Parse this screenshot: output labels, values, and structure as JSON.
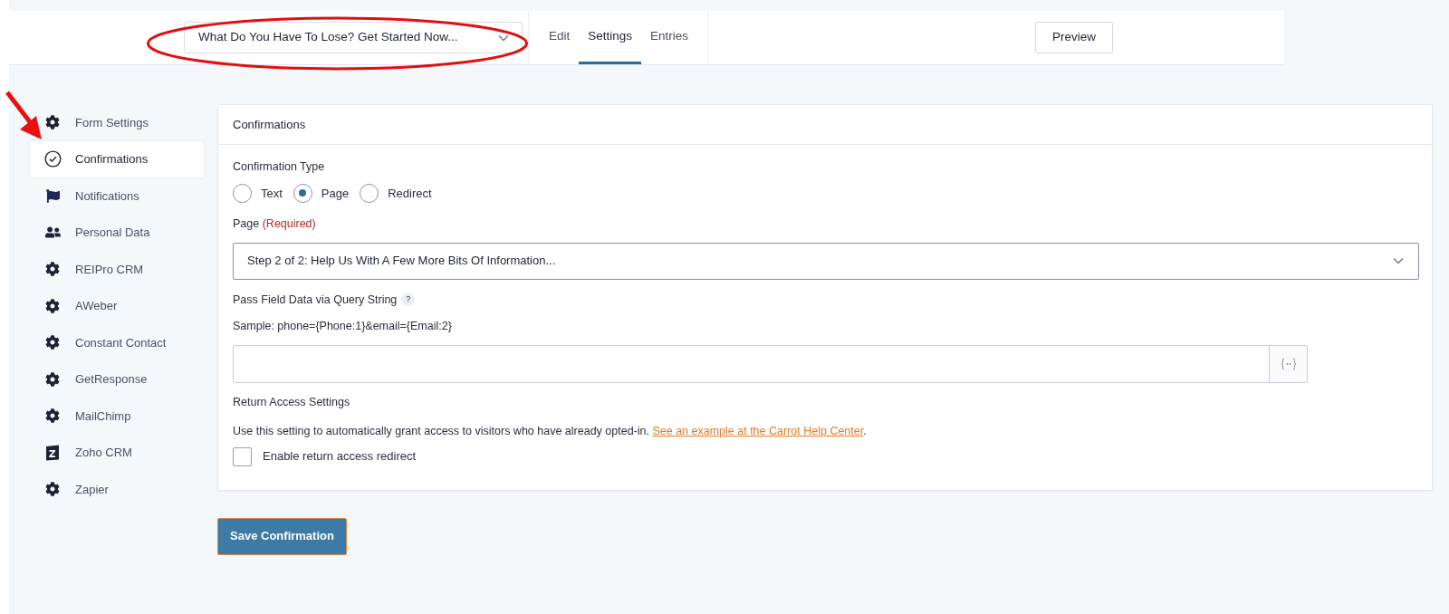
{
  "form_selector": {
    "value": "What Do You Have To Lose? Get Started Now..."
  },
  "tabs": [
    {
      "label": "Edit",
      "selected": false
    },
    {
      "label": "Settings",
      "selected": true
    },
    {
      "label": "Entries",
      "selected": false
    }
  ],
  "preview_button": "Preview",
  "sidebar": {
    "items": [
      {
        "label": "Form Settings",
        "kind": "gear",
        "selected": false
      },
      {
        "label": "Confirmations",
        "kind": "check",
        "selected": true
      },
      {
        "label": "Notifications",
        "kind": "flag",
        "selected": false
      },
      {
        "label": "Personal Data",
        "kind": "people",
        "selected": false
      },
      {
        "label": "REIPro CRM",
        "kind": "gear",
        "selected": false
      },
      {
        "label": "AWeber",
        "kind": "gear",
        "selected": false
      },
      {
        "label": "Constant Contact",
        "kind": "gear",
        "selected": false
      },
      {
        "label": "GetResponse",
        "kind": "gear",
        "selected": false
      },
      {
        "label": "MailChimp",
        "kind": "gear",
        "selected": false
      },
      {
        "label": "Zoho CRM",
        "kind": "zoho",
        "selected": false
      },
      {
        "label": "Zapier",
        "kind": "gear",
        "selected": false
      }
    ]
  },
  "panel": {
    "title": "Confirmations",
    "confirmation_type": {
      "label": "Confirmation Type",
      "options": [
        {
          "label": "Text",
          "selected": false
        },
        {
          "label": "Page",
          "selected": true
        },
        {
          "label": "Redirect",
          "selected": false
        }
      ]
    },
    "page_field": {
      "label": "Page",
      "required": "(Required)",
      "value": "Step 2 of 2: Help Us With A Few More Bits Of Information..."
    },
    "query_string": {
      "label": "Pass Field Data via Query String",
      "help": "?",
      "sample": "Sample: phone={Phone:1}&email={Email:2}"
    },
    "return_access": {
      "heading": "Return Access Settings",
      "description": "Use this setting to automatically grant access to visitors who have already opted-in.",
      "link": "See an example at the Carrot Help Center",
      "after_link": ".",
      "checkbox": {
        "label": "Enable return access redirect",
        "checked": false
      }
    }
  },
  "save_button": "Save Confirmation"
}
